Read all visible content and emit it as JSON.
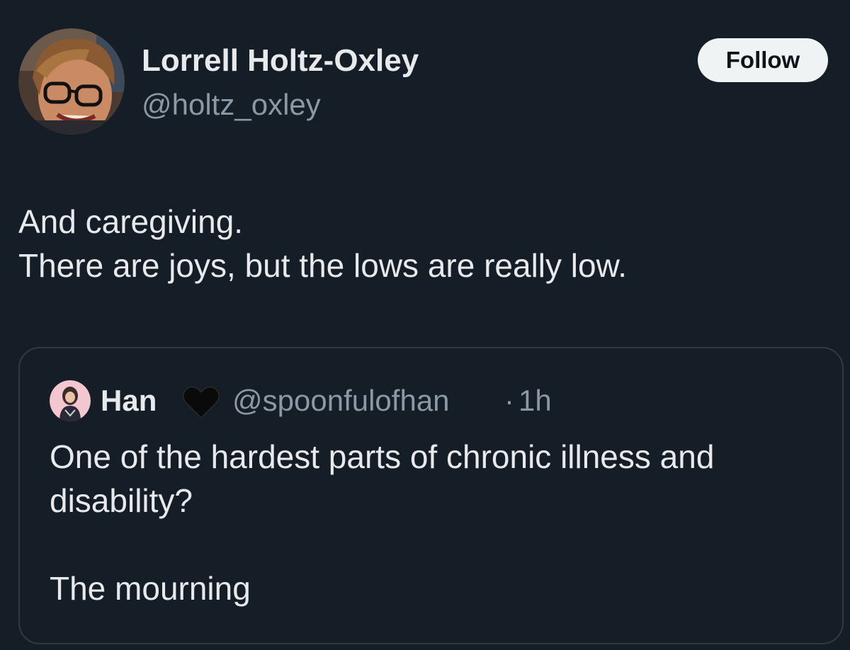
{
  "tweet": {
    "author": {
      "name": "Lorrell Holtz-Oxley",
      "handle": "@holtz_oxley",
      "avatar_icon": "profile-photo"
    },
    "follow_label": "Follow",
    "text_lines": [
      "And caregiving.",
      "There are joys, but the lows are really low."
    ]
  },
  "quote": {
    "author": {
      "name": "Han",
      "badge_icon": "black-heart-icon",
      "handle": "@spoonfulofhan",
      "separator": "·",
      "time": "1h",
      "avatar_icon": "profile-photo"
    },
    "text_lines": [
      "One of the hardest parts of chronic illness and",
      "disability?",
      "",
      "The mourning"
    ]
  },
  "colors": {
    "background": "#151d27",
    "text_primary": "#e7e9ea",
    "text_secondary": "#8b98a5",
    "follow_bg": "#eff3f4",
    "border": "#2f3a45"
  }
}
